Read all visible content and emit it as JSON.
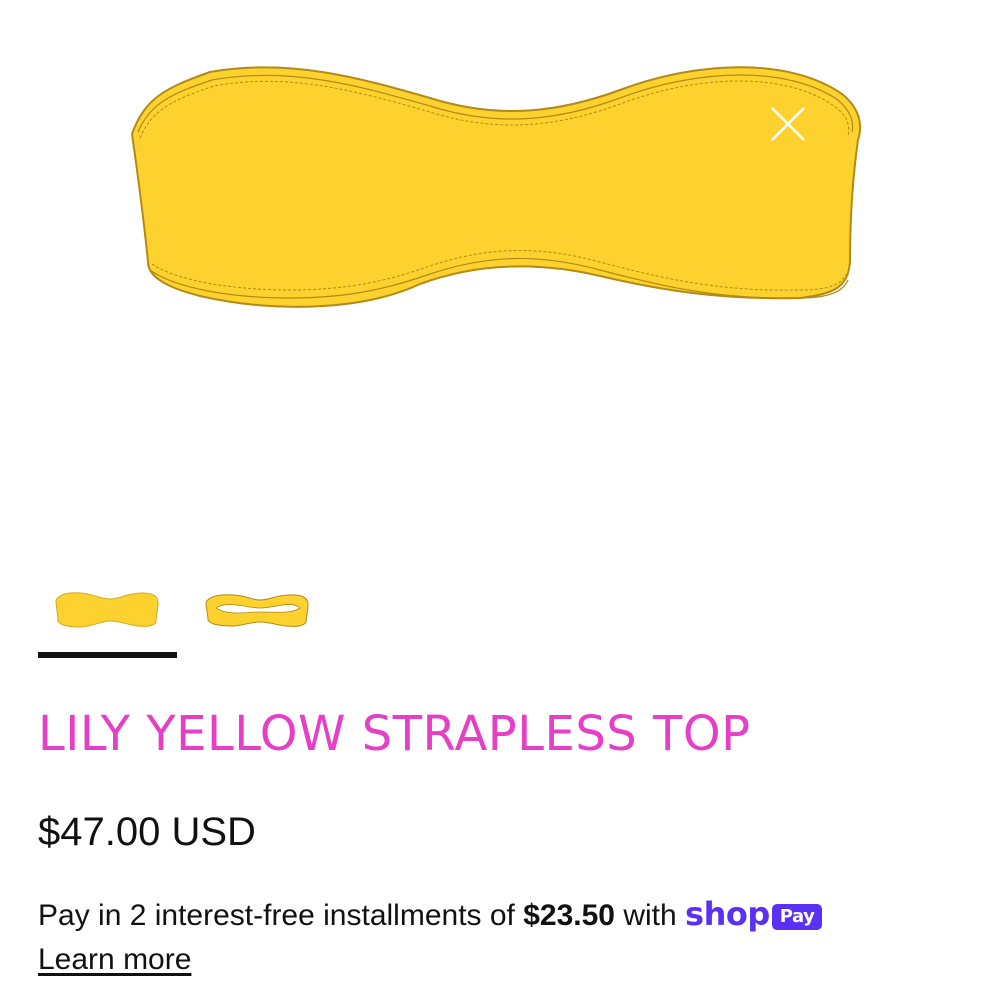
{
  "gallery": {
    "main_image_alt": "Lily Yellow Strapless Top - yellow bandeau",
    "close_icon": "close-icon",
    "thumbnails": [
      {
        "alt": "Front view yellow bandeau",
        "selected": true
      },
      {
        "alt": "Top view yellow bandeau",
        "selected": false
      }
    ]
  },
  "product": {
    "title": "LILY YELLOW STRAPLESS TOP",
    "price": "$47.00 USD"
  },
  "installments": {
    "prefix": "Pay in 2 interest-free installments of",
    "amount": "$23.50",
    "suffix": "with",
    "brand": "shop",
    "badge": "Pay",
    "learn_more": "Learn more"
  },
  "colors": {
    "title_color": "#e43fc6",
    "shop_purple": "#5a31f4",
    "garment_yellow": "#fdd22f"
  }
}
